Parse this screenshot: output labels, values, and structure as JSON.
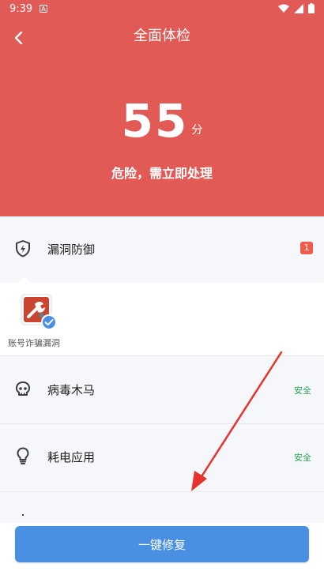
{
  "status_bar": {
    "time": "9:39",
    "notification_letter": "A"
  },
  "header": {
    "title": "全面体检",
    "score": "55",
    "score_unit": "分",
    "status": "危险，需立即处理",
    "background_color": "#e15a56"
  },
  "items": [
    {
      "label": "漏洞防御",
      "icon": "shield-bolt-icon",
      "badge": "1"
    },
    {
      "label": "病毒木马",
      "icon": "skull-icon",
      "status": "安全"
    },
    {
      "label": "耗电应用",
      "icon": "lightbulb-icon",
      "status": "安全"
    }
  ],
  "vulnerability_detail": {
    "app_label": "账号诈骗漏洞",
    "app_icon": "tools-icon"
  },
  "footer": {
    "button_label": "一键修复",
    "button_color": "#4a90e2"
  },
  "colors": {
    "safe": "#22a550",
    "badge": "#f25a4a",
    "annotation_arrow": "#e8322c"
  }
}
